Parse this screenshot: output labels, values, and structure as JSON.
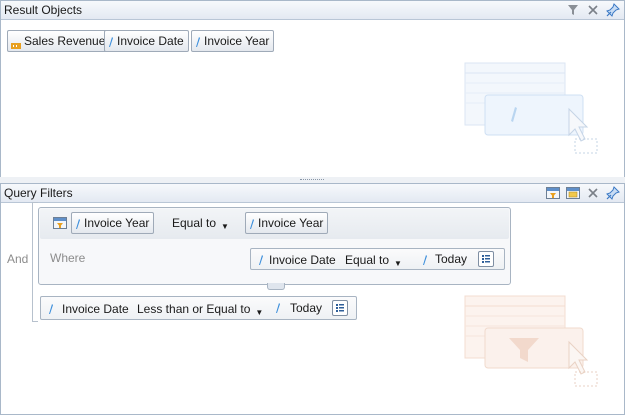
{
  "result_panel": {
    "title": "Result Objects",
    "objects": [
      {
        "label": "Sales Revenue",
        "kind": "measure"
      },
      {
        "label": "Invoice Date",
        "kind": "dimension"
      },
      {
        "label": "Invoice Year",
        "kind": "dimension"
      }
    ]
  },
  "filter_panel": {
    "title": "Query Filters",
    "and_label": "And",
    "where_label": "Where",
    "subquery": {
      "object": "Invoice Year",
      "operator": "Equal to",
      "operand": "Invoice Year",
      "where_condition": {
        "object": "Invoice Date",
        "operator": "Equal to",
        "operand": "Today"
      }
    },
    "condition": {
      "object": "Invoice Date",
      "operator": "Less than or Equal to",
      "operand": "Today"
    }
  },
  "colors": {
    "dimension": "#3d8fdc",
    "measure": "#e8a020",
    "border": "#a9b8c9"
  },
  "icons": [
    "filter-icon",
    "close-icon",
    "pin-icon",
    "subquery-icon",
    "ranking-icon",
    "list-icon"
  ]
}
